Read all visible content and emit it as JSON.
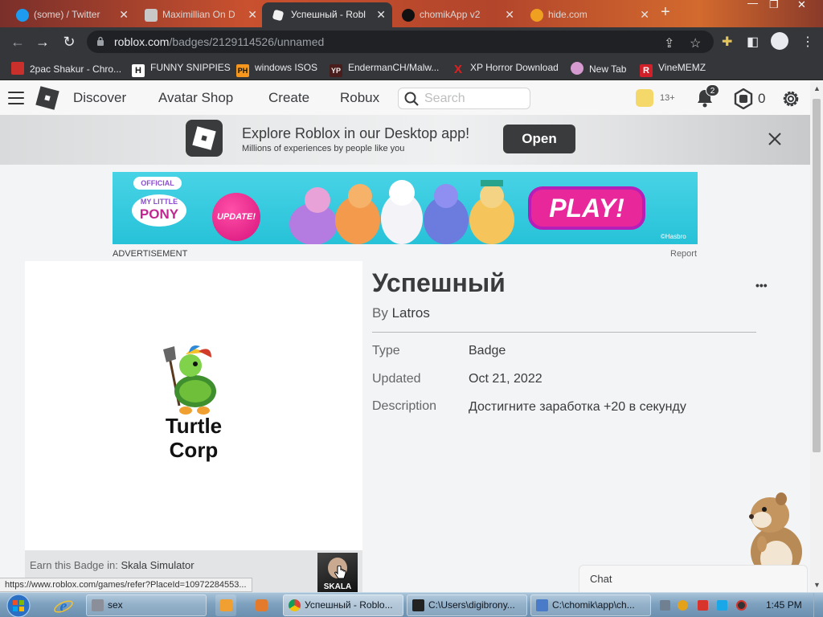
{
  "browser": {
    "tabs": [
      {
        "label": "(some) / Twitter",
        "icon": "twitter-icon",
        "color": "#1d9bf0"
      },
      {
        "label": "Maximillian On D",
        "icon": "page-icon",
        "color": "#d0d0d0"
      },
      {
        "label": "Успешный - Robl",
        "icon": "roblox-icon",
        "color": "#f1f1f1"
      },
      {
        "label": "chomikApp v2",
        "icon": "github-icon",
        "color": "#111111"
      },
      {
        "label": "hide.com",
        "icon": "globe-icon",
        "color": "#f0a020"
      }
    ],
    "url_domain": "roblox.com",
    "url_path": "/badges/2129114526/unnamed",
    "bookmarks": [
      {
        "label": "2pac Shakur - Chro...",
        "icon": "video-icon",
        "glyph": "",
        "color": "#c9302c"
      },
      {
        "label": "FUNNY SNIPPIES",
        "icon": "h-icon",
        "glyph": "H",
        "color": "#ffffff"
      },
      {
        "label": "windows ISOS",
        "icon": "ph-icon",
        "glyph": "PH",
        "color": "#f7971d"
      },
      {
        "label": "EndermanCH/Malw...",
        "icon": "yp-icon",
        "glyph": "YP",
        "color": "#4a1d1d"
      },
      {
        "label": "XP Horror Download",
        "icon": "x-icon",
        "glyph": "X",
        "color": "#e02020"
      },
      {
        "label": "New Tab",
        "icon": "avatar-icon",
        "glyph": "",
        "color": "#d59bd0"
      },
      {
        "label": "VineMEMZ",
        "icon": "r-icon",
        "glyph": "R",
        "color": "#d0202a"
      }
    ]
  },
  "roblox": {
    "nav": [
      "Discover",
      "Avatar Shop",
      "Create",
      "Robux"
    ],
    "search_placeholder": "Search",
    "age_label": "13+",
    "notification_count": "2",
    "robux_balance": "0",
    "app_banner": {
      "title": "Explore Roblox in our Desktop app!",
      "subtitle": "Millions of experiences by people like you",
      "open_label": "Open"
    },
    "ad": {
      "label": "ADVERTISEMENT",
      "report": "Report",
      "official": "OFFICIAL",
      "brand": "My Little Pony",
      "update": "UPDATE!",
      "play": "PLAY!",
      "hasbro": "©Hasbro"
    },
    "badge": {
      "title": "Успешный",
      "by_prefix": "By",
      "creator": "Latros",
      "thumbnail_text_1": "Turtle",
      "thumbnail_text_2": "Corp",
      "earn_prefix": "Earn this Badge in:",
      "game_name": "Skala Simulator",
      "game_thumb_label": "SKALA",
      "details": [
        {
          "label": "Type",
          "value": "Badge"
        },
        {
          "label": "Updated",
          "value": "Oct 21, 2022"
        },
        {
          "label": "Description",
          "value": "Достигните заработка +20 в секунду"
        }
      ]
    },
    "chat_label": "Chat"
  },
  "status_bar_url": "https://www.roblox.com/games/refer?PlaceId=10972284553...",
  "taskbar": {
    "items": [
      {
        "label": "sex",
        "color": "#8a8f99"
      },
      {
        "label": "Успешный - Roblo...",
        "color": "#3a8ee6"
      },
      {
        "label": "C:\\Users\\digibrony...",
        "color": "#222222"
      },
      {
        "label": "C:\\chomik\\app\\ch...",
        "color": "#4a7bc8"
      }
    ],
    "clock": "1:45 PM"
  }
}
